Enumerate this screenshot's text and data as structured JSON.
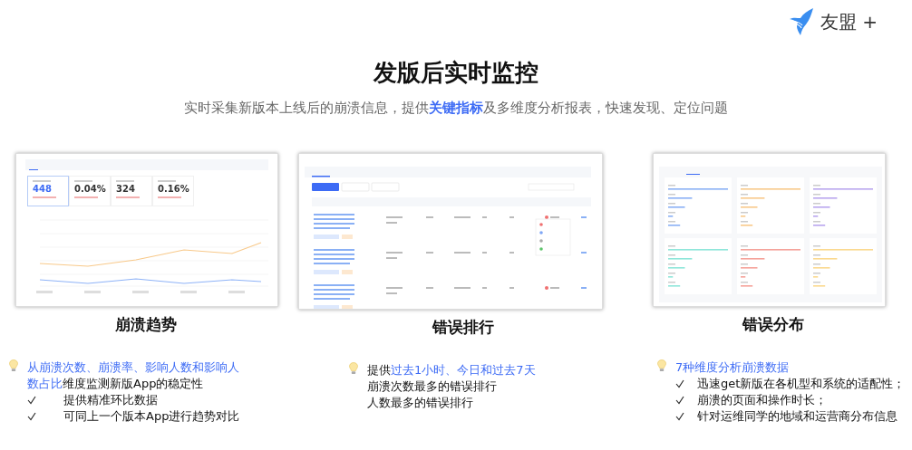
{
  "logo": {
    "text": "友盟 +"
  },
  "header": {
    "title": "发版后实时监控",
    "subtitle": "实时采集新版本上线后的崩溃信息，提供**关键指标**及多维度分析报表，快速发现、定位问题"
  },
  "features": [
    {
      "kind": "trend",
      "caption": "崩溃趋势",
      "stats": [
        {
          "value": "448",
          "selected": true
        },
        {
          "value": "0.04%",
          "selected": false
        },
        {
          "value": "324",
          "selected": false
        },
        {
          "value": "0.16%",
          "selected": false
        }
      ],
      "lead": [
        {
          "text": "从崩溃次数、崩溃率、影响人数和影响人数占比",
          "highlight": true
        },
        {
          "text": "维度监测新版App的稳定性",
          "highlight": false
        }
      ],
      "points": [
        {
          "text": "提供精准环比数据",
          "checked": true
        },
        {
          "text": "可同上一个版本App进行趋势对比",
          "checked": true
        }
      ]
    },
    {
      "kind": "ranking",
      "caption": "错误排行",
      "lead": [
        {
          "text": "提供",
          "highlight": false
        },
        {
          "text": "过去1小时、今日和过去7天",
          "highlight": true
        }
      ],
      "points": [
        {
          "text": "崩溃次数最多的错误排行",
          "checked": false
        },
        {
          "text": "人数最多的错误排行",
          "checked": false
        }
      ]
    },
    {
      "kind": "distribution",
      "caption": "错误分布",
      "lead": [
        {
          "text": "7种维度分析崩溃数据",
          "highlight": true
        }
      ],
      "points": [
        {
          "text": "迅速get新版在各机型和系统的适配性；",
          "checked": true
        },
        {
          "text": "崩溃的页面和操作时长；",
          "checked": true
        },
        {
          "text": "针对运维同学的地域和运营商分布信息",
          "checked": true
        }
      ]
    }
  ]
}
